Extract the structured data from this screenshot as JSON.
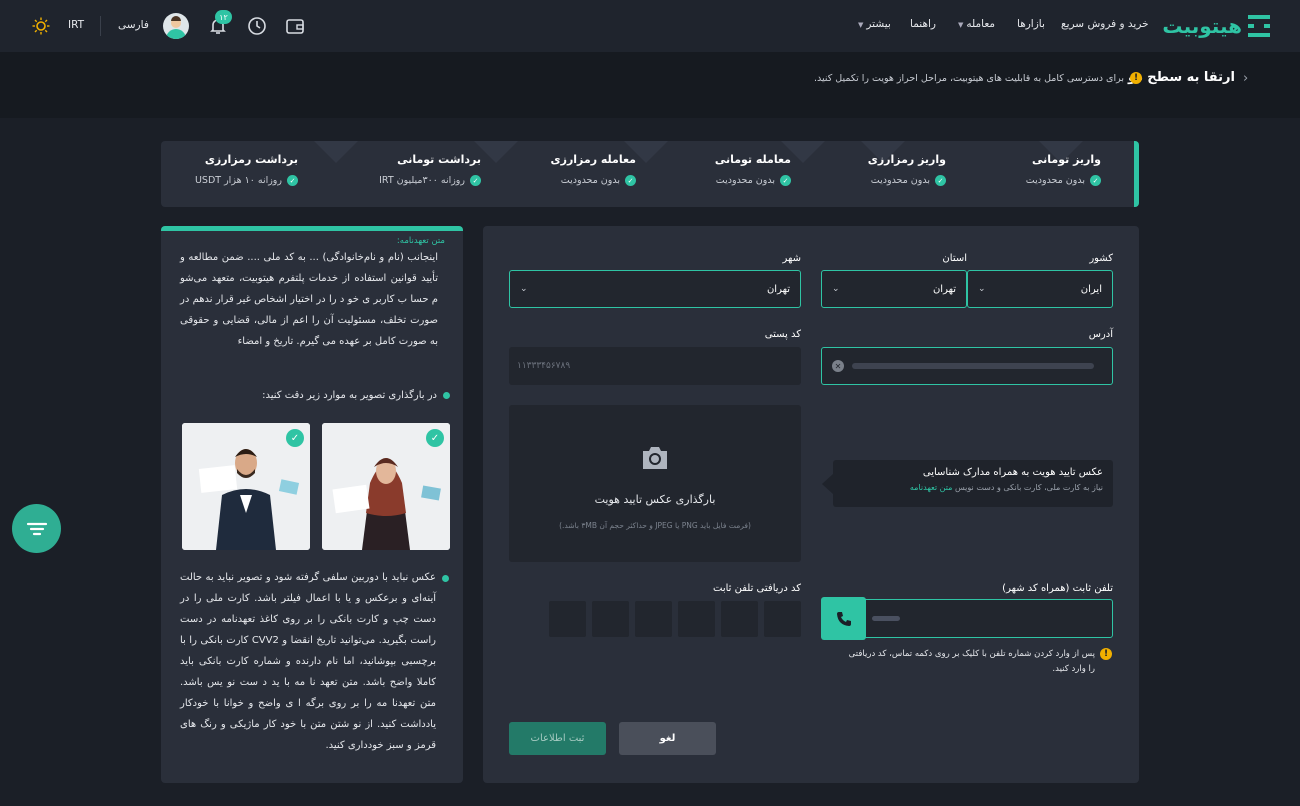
{
  "nav": {
    "logo_text": "هیتوبیت",
    "items": [
      "خرید و فروش سریع",
      "بازارها",
      "معامله",
      "راهنما",
      "بیشتر"
    ],
    "notifications_count": "۱۲",
    "language": "فارسی",
    "currency": "IRT"
  },
  "banner": {
    "title": "ارتقا به سطح دو",
    "description": "برای دسترسی کامل به قابلیت های هیتوبیت، مراحل احراز هویت را تکمیل کنید."
  },
  "limits": [
    {
      "title": "واریز تومانی",
      "sub": "بدون محدودیت"
    },
    {
      "title": "واریز رمزارزی",
      "sub": "بدون محدودیت"
    },
    {
      "title": "معامله تومانی",
      "sub": "بدون محدودیت"
    },
    {
      "title": "معامله رمزارزی",
      "sub": "بدون محدودیت"
    },
    {
      "title": "برداشت تومانی",
      "sub": "روزانه ۳۰۰میلیون IRT"
    },
    {
      "title": "برداشت رمزارزی",
      "sub": "روزانه ۱۰ هزار USDT"
    }
  ],
  "commitment": {
    "label": "متن تعهدنامه:",
    "text": "اینجانب (نام و نام‌خانوادگی) ... به کد ملی .... ضمن مطالعه و تأیید قوانین استفاده از خدمات پلتفرم هیتوبیت، متعهد می‌شو م حسا ب کاربر ی خو د را در اختیار اشخاص غیر قرار ندهم در صورت تخلف، مسئولیت آن را اعم از مالی، قضایی و حقوقی به صورت کامل بر عهده می گیرم. تاریخ و امضاء",
    "upload_tip": "در بارگذاری تصویر به موارد زیر دقت کنید:",
    "photo_rules": "عکس نباید با دوربین سلفی گرفته شود و تصویر نباید به حالت آینه‌ای و برعکس و یا با اعمال فیلتر باشد. کارت ملی را در دست چپ و کارت بانکی را بر روی کاغذ تعهدنامه در دست راست بگیرید. می‌توانید تاریخ انقضا و CVV2 کارت بانکی را با برچسبی بپوشانید، اما نام دارنده و شماره کارت بانکی باید کاملا واضح باشد. متن تعهد نا مه با ید د ست نو یس باشد. متن تعهدنا مه را بر روی برگه ا ی واضح و خوانا با خودکار یادداشت کنید. از نو شتن متن با خود کار ماژیکی و رنگ های قرمز و سبز خودداری کنید."
  },
  "form": {
    "country_label": "کشور",
    "country_value": "ایران",
    "province_label": "استان",
    "province_value": "تهران",
    "city_label": "شهر",
    "city_value": "تهران",
    "address_label": "آدرس",
    "postal_label": "کد پستی",
    "postal_placeholder": "۱۱۳۳۳۴۵۶۷۸۹",
    "upload_title": "بارگذاری عکس تایید هویت",
    "upload_hint": "(فرمت فایل باید PNG یا JPEG و حداکثر حجم آن ۳MB باشد.)",
    "note_title": "عکس تایید هویت به همراه مدارک شناسایی",
    "note_sub": "نیاز به کارت ملی، کارت بانکی و دست نویس",
    "note_link": "متن تعهدنامه",
    "phone_label": "تلفن ثابت (همراه کد شهر)",
    "code_label": "کد دریافتی تلفن ثابت",
    "phone_note": "پس از وارد کردن شماره تلفن با کلیک بر روی دکمه تماس، کد دریافتی را وارد کنید.",
    "cancel_label": "لغو",
    "submit_label": "ثبت اطلاعات"
  },
  "colors": {
    "accent": "#2fc4a4",
    "warning": "#f1b000"
  }
}
